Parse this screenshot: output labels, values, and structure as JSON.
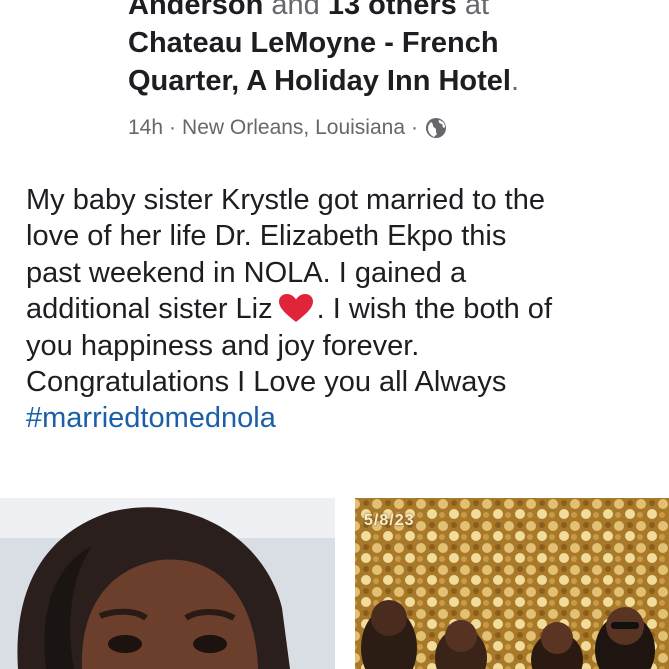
{
  "post": {
    "tag_line": {
      "tagged_name": "Anderson",
      "and_text": " and ",
      "others": "13 others",
      "at_text": " at"
    },
    "location_line1": "Chateau LeMoyne - French",
    "location_line2": "Quarter, A Holiday Inn Hotel",
    "location_end": ".",
    "time": "14h",
    "separator": " · ",
    "place": "New Orleans, Louisiana",
    "privacy_icon": "globe-icon",
    "body_lines": [
      "My baby sister Krystle got married to the",
      "love of her life Dr. Elizabeth Ekpo this",
      "past weekend in NOLA. I gained a",
      "additional sister Liz",
      ". I wish the both of",
      "you happiness and joy forever.",
      "Congratulations I Love you all Always"
    ],
    "emoji": "heart-emoji",
    "hashtag": "#marriedtomednola",
    "photo_stamp": "5/8/23"
  },
  "colors": {
    "text": "#1c1e21",
    "muted": "#65676b",
    "link": "#1b5fa8",
    "heart": "#e0243a"
  }
}
